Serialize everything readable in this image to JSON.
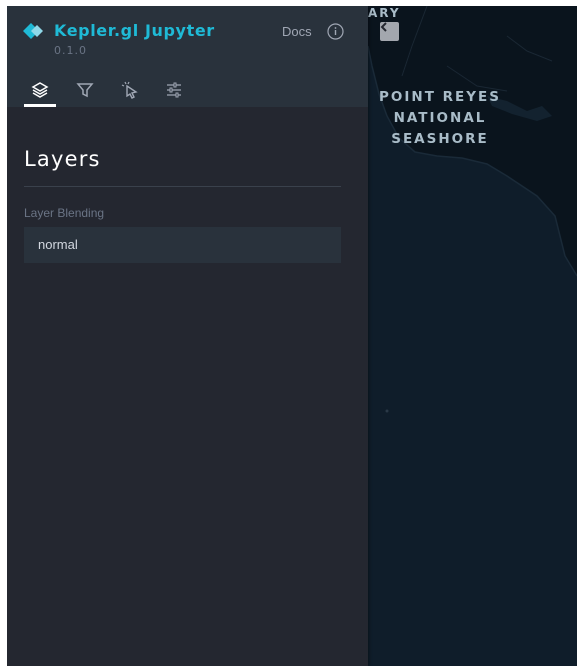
{
  "app": {
    "title": "Kepler.gl Jupyter",
    "version": "0.1.0"
  },
  "header": {
    "docs_label": "Docs",
    "info_icon": "info-icon"
  },
  "tabs": [
    {
      "id": "layers",
      "icon": "layers-icon",
      "active": true
    },
    {
      "id": "filters",
      "icon": "filter-icon",
      "active": false
    },
    {
      "id": "interactions",
      "icon": "cursor-click-icon",
      "active": false
    },
    {
      "id": "map-style",
      "icon": "sliders-icon",
      "active": false
    }
  ],
  "panel": {
    "title": "Layers",
    "layer_blending": {
      "label": "Layer Blending",
      "value": "normal"
    }
  },
  "map": {
    "labels": {
      "top_partial": "ARY",
      "park_line1": "POINT REYES",
      "park_line2": "NATIONAL",
      "park_line3": "SEASHORE"
    },
    "collapse_icon": "chevron-left-icon"
  },
  "colors": {
    "accent": "#1fbad6",
    "panel_bg": "#242730",
    "header_bg": "#29323c",
    "map_water": "#0f1d2a",
    "map_land": "#0b1620"
  }
}
